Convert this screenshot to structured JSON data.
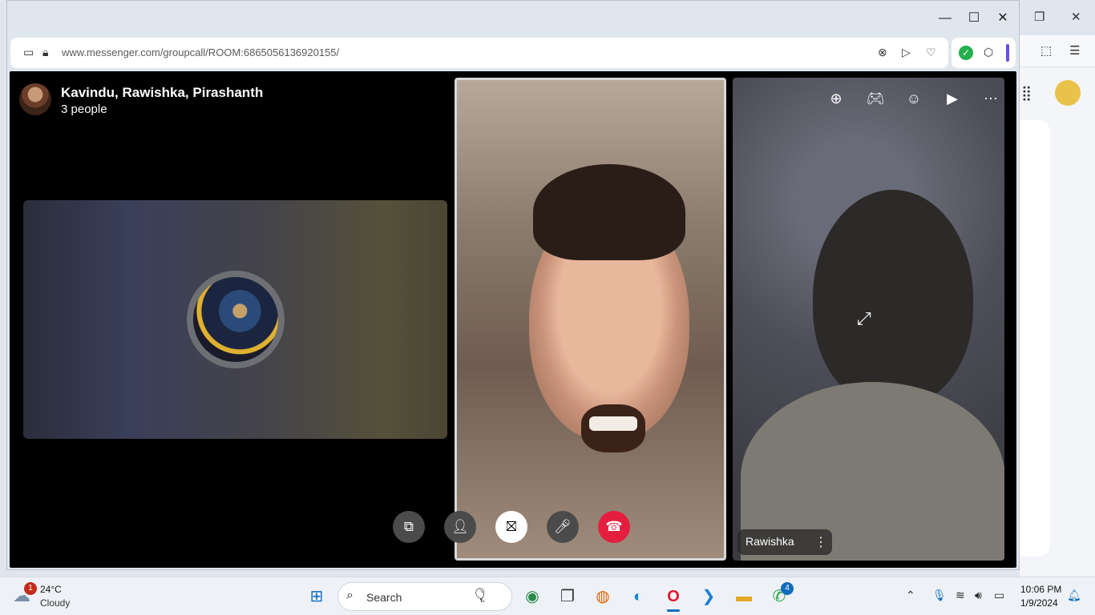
{
  "browser": {
    "url": "www.messenger.com/groupcall/ROOM:6865056136920155/",
    "window_controls": {
      "minimize": "—",
      "maximize": "☐",
      "close": "✕"
    }
  },
  "call": {
    "title": "Kavindu, Rawishka, Pirashanth",
    "subtitle": "3 people",
    "participants": [
      {
        "name": "Rawishka",
        "more": "⋮"
      }
    ],
    "top_controls": [
      "add",
      "games",
      "effects",
      "screen",
      "more"
    ],
    "controls": [
      "share-screen",
      "add-person",
      "camera-off",
      "microphone",
      "end-call"
    ]
  },
  "taskbar": {
    "weather": {
      "badge": "1",
      "temp": "24°C",
      "desc": "Cloudy"
    },
    "search_placeholder": "Search",
    "apps": [
      "windows",
      "search",
      "copilot",
      "file-manager",
      "firefox",
      "edge",
      "opera",
      "vscode",
      "explorer",
      "whatsapp"
    ],
    "whatsapp_badge": "4",
    "time": "10:06 PM",
    "date": "1/9/2024"
  },
  "colors": {
    "end_call": "#e41e3f",
    "accent": "#0f6cbd"
  }
}
